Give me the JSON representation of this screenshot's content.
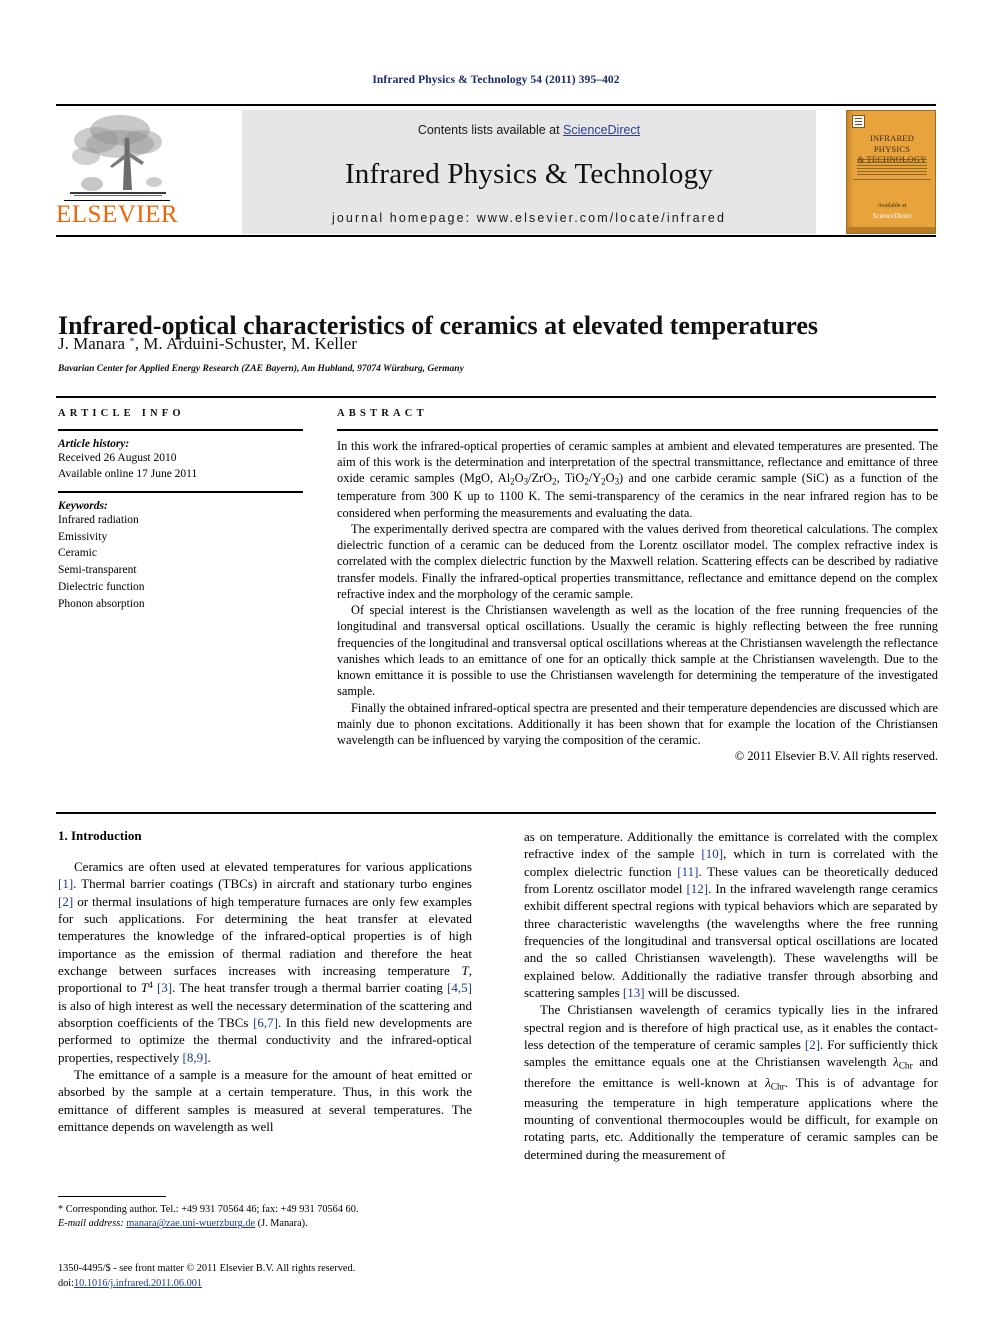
{
  "running_head": "Infrared Physics & Technology 54 (2011) 395–402",
  "masthead": {
    "publisher_name": "ELSEVIER",
    "contents_prefix": "Contents lists available at ",
    "sciencedirect": "ScienceDirect",
    "journal_name": "Infrared Physics & Technology",
    "homepage": "journal homepage: www.elsevier.com/locate/infrared",
    "cover": {
      "title_line1": "INFRARED PHYSICS",
      "title_line2": "& TECHNOLOGY",
      "footer_label": "Available at",
      "footer_brand": "ScienceDirect",
      "background_color": "#e8a33d"
    }
  },
  "article": {
    "title": "Infrared-optical characteristics of ceramics at elevated temperatures",
    "authors": "J. Manara *, M. Arduini-Schuster, M. Keller",
    "affiliation": "Bavarian Center for Applied Energy Research (ZAE Bayern), Am Hubland, 97074 Würzburg, Germany"
  },
  "info": {
    "heading": "ARTICLE INFO",
    "history_label": "Article history:",
    "history": [
      "Received 26 August 2010",
      "Available online 17 June 2011"
    ],
    "keywords_label": "Keywords:",
    "keywords": [
      "Infrared radiation",
      "Emissivity",
      "Ceramic",
      "Semi-transparent",
      "Dielectric function",
      "Phonon absorption"
    ]
  },
  "abstract": {
    "heading": "ABSTRACT",
    "paragraphs": [
      "In this work the infrared-optical properties of ceramic samples at ambient and elevated temperatures are presented. The aim of this work is the determination and interpretation of the spectral transmittance, reflectance and emittance of three oxide ceramic samples (MgO, Al2O3/ZrO2, TiO2/Y2O3) and one carbide ceramic sample (SiC) as a function of the temperature from 300 K up to 1100 K. The semi-transparency of the ceramics in the near infrared region has to be considered when performing the measurements and evaluating the data.",
      "The experimentally derived spectra are compared with the values derived from theoretical calculations. The complex dielectric function of a ceramic can be deduced from the Lorentz oscillator model. The complex refractive index is correlated with the complex dielectric function by the Maxwell relation. Scattering effects can be described by radiative transfer models. Finally the infrared-optical properties transmittance, reflectance and emittance depend on the complex refractive index and the morphology of the ceramic sample.",
      "Of special interest is the Christiansen wavelength as well as the location of the free running frequencies of the longitudinal and transversal optical oscillations. Usually the ceramic is highly reflecting between the free running frequencies of the longitudinal and transversal optical oscillations whereas at the Christiansen wavelength the reflectance vanishes which leads to an emittance of one for an optically thick sample at the Christiansen wavelength. Due to the known emittance it is possible to use the Christiansen wavelength for determining the temperature of the investigated sample.",
      "Finally the obtained infrared-optical spectra are presented and their temperature dependencies are discussed which are mainly due to phonon excitations. Additionally it has been shown that for example the location of the Christiansen wavelength can be influenced by varying the composition of the ceramic."
    ],
    "copyright": "© 2011 Elsevier B.V. All rights reserved."
  },
  "body": {
    "section_heading": "1. Introduction",
    "left_paragraphs": [
      "Ceramics are often used at elevated temperatures for various applications [1]. Thermal barrier coatings (TBCs) in aircraft and stationary turbo engines [2] or thermal insulations of high temperature furnaces are only few examples for such applications. For determining the heat transfer at elevated temperatures the knowledge of the infrared-optical properties is of high importance as the emission of thermal radiation and therefore the heat exchange between surfaces increases with increasing temperature T, proportional to T4 [3]. The heat transfer trough a thermal barrier coating [4,5] is also of high interest as well the necessary determination of the scattering and absorption coefficients of the TBCs [6,7]. In this field new developments are performed to optimize the thermal conductivity and the infrared-optical properties, respectively [8,9].",
      "The emittance of a sample is a measure for the amount of heat emitted or absorbed by the sample at a certain temperature. Thus, in this work the emittance of different samples is measured at several temperatures. The emittance depends on wavelength as well"
    ],
    "right_paragraphs": [
      "as on temperature. Additionally the emittance is correlated with the complex refractive index of the sample [10], which in turn is correlated with the complex dielectric function [11]. These values can be theoretically deduced from Lorentz oscillator model [12]. In the infrared wavelength range ceramics exhibit different spectral regions with typical behaviors which are separated by three characteristic wavelengths (the wavelengths where the free running frequencies of the longitudinal and transversal optical oscillations are located and the so called Christiansen wavelength). These wavelengths will be explained below. Additionally the radiative transfer through absorbing and scattering samples [13] will be discussed.",
      "The Christiansen wavelength of ceramics typically lies in the infrared spectral region and is therefore of high practical use, as it enables the contact-less detection of the temperature of ceramic samples [2]. For sufficiently thick samples the emittance equals one at the Christiansen wavelength λChr and therefore the emittance is well-known at λChr. This is of advantage for measuring the temperature in high temperature applications where the mounting of conventional thermocouples would be difficult, for example on rotating parts, etc. Additionally the temperature of ceramic samples can be determined during the measurement of"
    ]
  },
  "footnote": {
    "corresponding": "* Corresponding author. Tel.: +49 931 70564 46; fax: +49 931 70564 60.",
    "email_label": "E-mail address:",
    "email": "manara@zae.uni-wuerzburg.de",
    "email_suffix": "(J. Manara)."
  },
  "footer": {
    "issn_line": "1350-4495/$ - see front matter © 2011 Elsevier B.V. All rights reserved.",
    "doi_label": "doi:",
    "doi": "10.1016/j.infrared.2011.06.001"
  },
  "colors": {
    "link": "#1b3a8f",
    "sciencedirect": "#2c3f96",
    "elsevier_orange": "#eb6608",
    "running_head": "#1b2a6b"
  }
}
